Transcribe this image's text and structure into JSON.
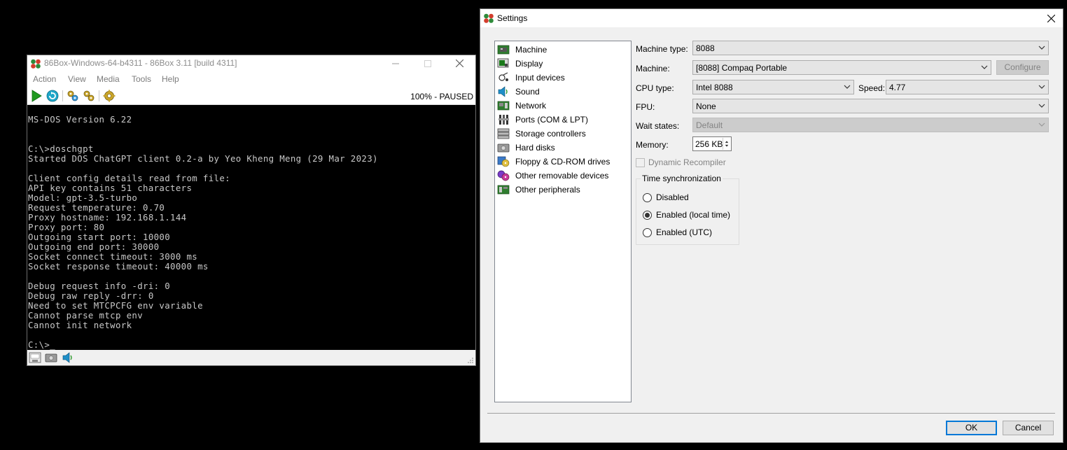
{
  "emulator": {
    "title": "86Box-Windows-64-b4311 - 86Box 3.11 [build 4311]",
    "menu": [
      "Action",
      "View",
      "Media",
      "Tools",
      "Help"
    ],
    "toolbar_icons": [
      "play-icon",
      "reset-icon",
      "ctrl-alt-del-icon",
      "ctrl-alt-esc-icon",
      "settings-icon"
    ],
    "status": "100% - PAUSED",
    "screen_text": "MS-DOS Version 6.22\n\n\nC:\\>doschgpt\nStarted DOS ChatGPT client 0.2-a by Yeo Kheng Meng (29 Mar 2023)\n\nClient config details read from file:\nAPI key contains 51 characters\nModel: gpt-3.5-turbo\nRequest temperature: 0.70\nProxy hostname: 192.168.1.144\nProxy port: 80\nOutgoing start port: 10000\nOutgoing end port: 30000\nSocket connect timeout: 3000 ms\nSocket response timeout: 40000 ms\n\nDebug request info -dri: 0\nDebug raw reply -drr: 0\nNeed to set MTCPCFG env variable\nCannot parse mtcp env\nCannot init network\n\nC:\\>_",
    "statusbar_icons": [
      "floppy-drive-icon",
      "hard-disk-icon",
      "sound-icon"
    ]
  },
  "settings": {
    "title": "Settings",
    "categories": [
      {
        "label": "Machine",
        "icon": "machine-icon"
      },
      {
        "label": "Display",
        "icon": "display-icon"
      },
      {
        "label": "Input devices",
        "icon": "input-devices-icon"
      },
      {
        "label": "Sound",
        "icon": "sound-icon"
      },
      {
        "label": "Network",
        "icon": "network-icon"
      },
      {
        "label": "Ports (COM & LPT)",
        "icon": "ports-icon"
      },
      {
        "label": "Storage controllers",
        "icon": "storage-controllers-icon"
      },
      {
        "label": "Hard disks",
        "icon": "hard-disks-icon"
      },
      {
        "label": "Floppy & CD-ROM drives",
        "icon": "floppy-cdrom-icon"
      },
      {
        "label": "Other removable devices",
        "icon": "removable-devices-icon"
      },
      {
        "label": "Other peripherals",
        "icon": "peripherals-icon"
      }
    ],
    "machine_type_label": "Machine type:",
    "machine_type_value": "8088",
    "machine_label": "Machine:",
    "machine_value": "[8088] Compaq Portable",
    "configure_label": "Configure",
    "cpu_type_label": "CPU type:",
    "cpu_type_value": "Intel 8088",
    "speed_label": "Speed:",
    "speed_value": "4.77",
    "fpu_label": "FPU:",
    "fpu_value": "None",
    "wait_states_label": "Wait states:",
    "wait_states_value": "Default",
    "memory_label": "Memory:",
    "memory_value": "256 KB",
    "dynamic_recompiler_label": "Dynamic Recompiler",
    "time_sync_title": "Time synchronization",
    "time_sync_options": [
      "Disabled",
      "Enabled (local time)",
      "Enabled (UTC)"
    ],
    "time_sync_selected": "Enabled (local time)",
    "ok_label": "OK",
    "cancel_label": "Cancel"
  }
}
